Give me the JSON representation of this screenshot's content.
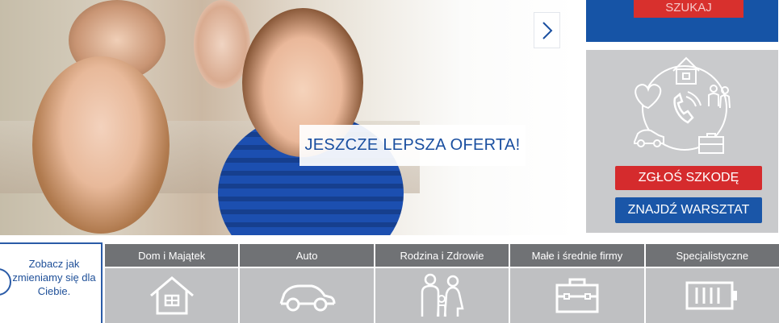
{
  "hero": {
    "caption": "JESZCZE LEPSZA OFERTA!",
    "next_icon": "chevron-right-icon"
  },
  "search_panel": {
    "button_label": "SZUKAJ"
  },
  "claim_panel": {
    "illustration_icon": "family-home-contact-illustration",
    "report_label": "ZGŁOŚ SZKODĘ",
    "workshop_label": "ZNAJDŹ WARSZTAT"
  },
  "promo": {
    "text": "Zobacz jak zmieniamy się dla Ciebie.",
    "icon": "circle-arrow-icon"
  },
  "categories": [
    {
      "label": "Dom i Majątek",
      "icon": "house-icon"
    },
    {
      "label": "Auto",
      "icon": "car-icon"
    },
    {
      "label": "Rodzina i Zdrowie",
      "icon": "family-icon"
    },
    {
      "label": "Małe i średnie firmy",
      "icon": "briefcase-icon"
    },
    {
      "label": "Specjalistyczne",
      "icon": "battery-icon"
    }
  ],
  "colors": {
    "brand_blue": "#1654a6",
    "alert_red": "#d52b2d",
    "category_header": "#707275",
    "category_body": "#bfc0c2"
  }
}
